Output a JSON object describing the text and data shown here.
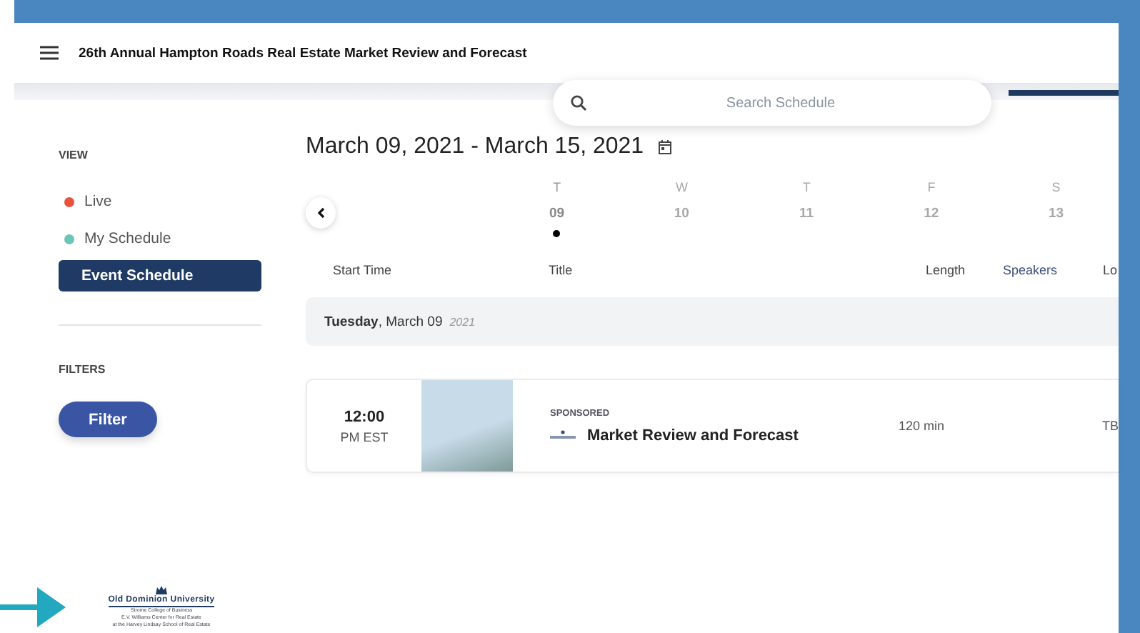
{
  "header": {
    "title": "26th Annual Hampton Roads Real Estate Market Review and Forecast"
  },
  "search": {
    "placeholder": "Search Schedule"
  },
  "sidebar": {
    "view_label": "VIEW",
    "views": [
      {
        "label": "Live",
        "color": "#e8533f",
        "selected": false
      },
      {
        "label": "My Schedule",
        "color": "#6cc5b5",
        "selected": false
      },
      {
        "label": "Event Schedule",
        "selected": true
      }
    ],
    "filters_label": "FILTERS",
    "filter_button": "Filter",
    "logo": {
      "name": "Old Dominion University",
      "line_1": "Strome College of Business",
      "line_2": "E.V. Williams Center for Real Estate",
      "line_3": "at the Harvey Lindsay School of Real Estate"
    }
  },
  "date_range": "March 09, 2021 - March 15, 2021",
  "week": [
    {
      "weekday": "T",
      "day": "09",
      "selected": true,
      "has_events": true
    },
    {
      "weekday": "W",
      "day": "10",
      "selected": false,
      "has_events": false
    },
    {
      "weekday": "T",
      "day": "11",
      "selected": false,
      "has_events": false
    },
    {
      "weekday": "F",
      "day": "12",
      "selected": false,
      "has_events": false
    },
    {
      "weekday": "S",
      "day": "13",
      "selected": false,
      "has_events": false
    }
  ],
  "table": {
    "columns": [
      "Start Time",
      "Title",
      "Length",
      "Speakers",
      "Lo"
    ],
    "day_group": {
      "label": "**Tuesday**, March 09",
      "year": "2021"
    },
    "rows": [
      {
        "time": "12:00",
        "period": "PM EST",
        "badge": "SPONSORED",
        "title": "Market Review and Forecast",
        "length": "120 min",
        "speakers": "TB"
      }
    ]
  }
}
